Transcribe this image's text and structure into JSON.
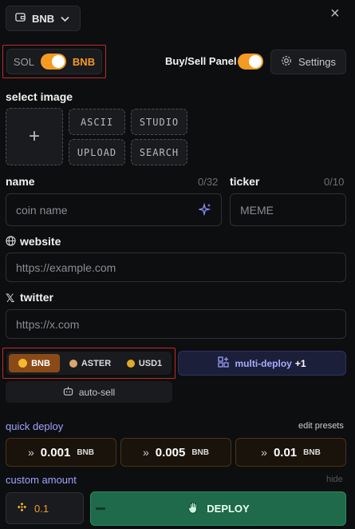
{
  "header": {
    "chain": "BNB",
    "close": "×"
  },
  "chain_toggle": {
    "left": "SOL",
    "right": "BNB"
  },
  "panel": {
    "label": "Buy/Sell Panel",
    "settings": "Settings"
  },
  "image": {
    "title": "select image",
    "plus": "+",
    "ascii": "ASCII",
    "studio": "STUDIO",
    "upload": "UPLOAD",
    "search": "SEARCH"
  },
  "name": {
    "label": "name",
    "count": "0/32",
    "placeholder": "coin name"
  },
  "ticker": {
    "label": "ticker",
    "count": "0/10",
    "placeholder": "MEME"
  },
  "website": {
    "label": "website",
    "placeholder": "https://example.com"
  },
  "twitter": {
    "label": "twitter",
    "placeholder": "https://x.com"
  },
  "currency": {
    "options": [
      "BNB",
      "ASTER",
      "USD1"
    ],
    "selected": "BNB"
  },
  "multi": {
    "label": "multi-deploy",
    "badge": "+1"
  },
  "autosell": {
    "label": "auto-sell"
  },
  "quick": {
    "label": "quick deploy",
    "edit": "edit presets",
    "presets": [
      {
        "v": "0.001",
        "u": "BNB"
      },
      {
        "v": "0.005",
        "u": "BNB"
      },
      {
        "v": "0.01",
        "u": "BNB"
      }
    ]
  },
  "custom": {
    "label": "custom amount",
    "hide": "hide",
    "value": "0.1"
  },
  "deploy": {
    "label": "DEPLOY"
  },
  "colors": {
    "accent": "#f59a23",
    "deploy": "#1e6a4a",
    "multi": "#1c1f3a"
  }
}
